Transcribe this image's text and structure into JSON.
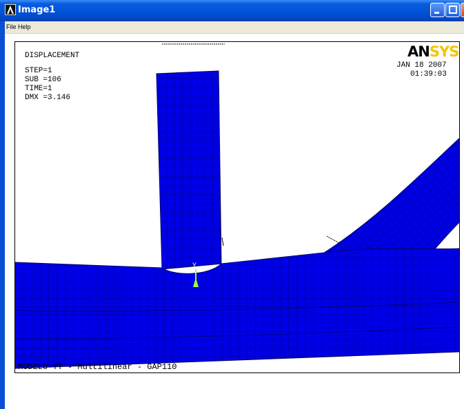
{
  "window": {
    "title": "Image1"
  },
  "menu": {
    "file": "File",
    "help": "Help"
  },
  "info": {
    "result": "DISPLACEMENT",
    "step": "STEP=1",
    "sub": "SUB =106",
    "time": "TIME=1",
    "dmx": "DMX =3.146"
  },
  "stamp": {
    "date": "JAN 18 2007",
    "time": "01:39:03"
  },
  "logo": {
    "an": "AN",
    "sys": "SYS"
  },
  "axis": {
    "y": "Y"
  },
  "footer": {
    "title": "MODELO YT - Multilinear - GAP110"
  },
  "colors": {
    "mesh_fill": "#0000e6",
    "mesh_line": "#000066",
    "triad": "#9dff3a",
    "brand": "#f5c400"
  }
}
